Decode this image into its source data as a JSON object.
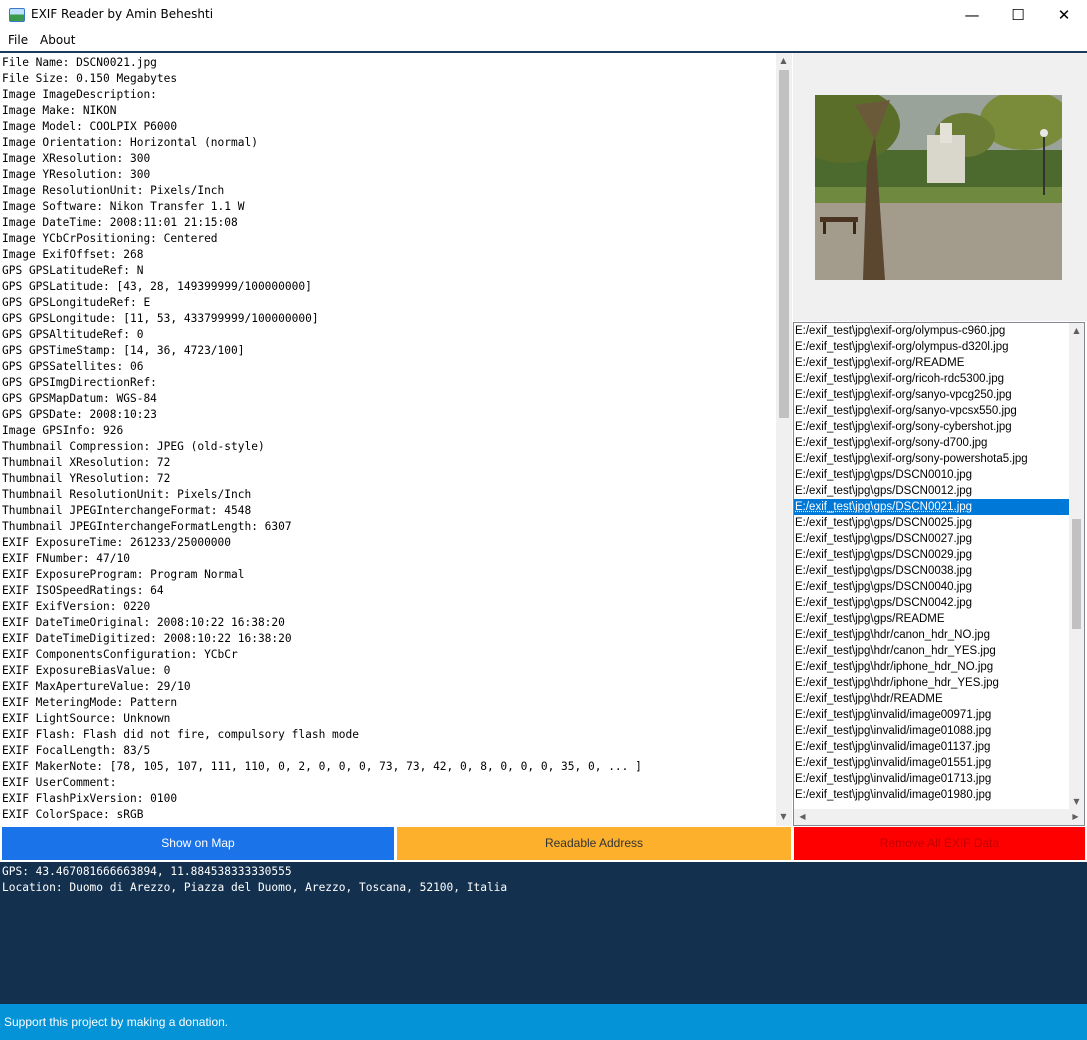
{
  "window": {
    "title": "EXIF Reader by Amin Beheshti",
    "minimize_glyph": "—",
    "maximize_glyph": "☐",
    "close_glyph": "✕"
  },
  "menu": {
    "items": [
      "File",
      "About"
    ]
  },
  "exif_lines": [
    "File Name: DSCN0021.jpg",
    "File Size: 0.150 Megabytes",
    "Image ImageDescription:",
    "Image Make: NIKON",
    "Image Model: COOLPIX P6000",
    "Image Orientation: Horizontal (normal)",
    "Image XResolution: 300",
    "Image YResolution: 300",
    "Image ResolutionUnit: Pixels/Inch",
    "Image Software: Nikon Transfer 1.1 W",
    "Image DateTime: 2008:11:01 21:15:08",
    "Image YCbCrPositioning: Centered",
    "Image ExifOffset: 268",
    "GPS GPSLatitudeRef: N",
    "GPS GPSLatitude: [43, 28, 149399999/100000000]",
    "GPS GPSLongitudeRef: E",
    "GPS GPSLongitude: [11, 53, 433799999/100000000]",
    "GPS GPSAltitudeRef: 0",
    "GPS GPSTimeStamp: [14, 36, 4723/100]",
    "GPS GPSSatellites: 06",
    "GPS GPSImgDirectionRef:",
    "GPS GPSMapDatum: WGS-84",
    "GPS GPSDate: 2008:10:23",
    "Image GPSInfo: 926",
    "Thumbnail Compression: JPEG (old-style)",
    "Thumbnail XResolution: 72",
    "Thumbnail YResolution: 72",
    "Thumbnail ResolutionUnit: Pixels/Inch",
    "Thumbnail JPEGInterchangeFormat: 4548",
    "Thumbnail JPEGInterchangeFormatLength: 6307",
    "EXIF ExposureTime: 261233/25000000",
    "EXIF FNumber: 47/10",
    "EXIF ExposureProgram: Program Normal",
    "EXIF ISOSpeedRatings: 64",
    "EXIF ExifVersion: 0220",
    "EXIF DateTimeOriginal: 2008:10:22 16:38:20",
    "EXIF DateTimeDigitized: 2008:10:22 16:38:20",
    "EXIF ComponentsConfiguration: YCbCr",
    "EXIF ExposureBiasValue: 0",
    "EXIF MaxApertureValue: 29/10",
    "EXIF MeteringMode: Pattern",
    "EXIF LightSource: Unknown",
    "EXIF Flash: Flash did not fire, compulsory flash mode",
    "EXIF FocalLength: 83/5",
    "EXIF MakerNote: [78, 105, 107, 111, 110, 0, 2, 0, 0, 0, 73, 73, 42, 0, 8, 0, 0, 0, 35, 0, ... ]",
    "EXIF UserComment:",
    "EXIF FlashPixVersion: 0100",
    "EXIF ColorSpace: sRGB"
  ],
  "file_list": {
    "selected_index": 11,
    "items": [
      "E:/exif_test\\jpg\\exif-org/olympus-c960.jpg",
      "E:/exif_test\\jpg\\exif-org/olympus-d320l.jpg",
      "E:/exif_test\\jpg\\exif-org/README",
      "E:/exif_test\\jpg\\exif-org/ricoh-rdc5300.jpg",
      "E:/exif_test\\jpg\\exif-org/sanyo-vpcg250.jpg",
      "E:/exif_test\\jpg\\exif-org/sanyo-vpcsx550.jpg",
      "E:/exif_test\\jpg\\exif-org/sony-cybershot.jpg",
      "E:/exif_test\\jpg\\exif-org/sony-d700.jpg",
      "E:/exif_test\\jpg\\exif-org/sony-powershota5.jpg",
      "E:/exif_test\\jpg\\gps/DSCN0010.jpg",
      "E:/exif_test\\jpg\\gps/DSCN0012.jpg",
      "E:/exif_test\\jpg\\gps/DSCN0021.jpg",
      "E:/exif_test\\jpg\\gps/DSCN0025.jpg",
      "E:/exif_test\\jpg\\gps/DSCN0027.jpg",
      "E:/exif_test\\jpg\\gps/DSCN0029.jpg",
      "E:/exif_test\\jpg\\gps/DSCN0038.jpg",
      "E:/exif_test\\jpg\\gps/DSCN0040.jpg",
      "E:/exif_test\\jpg\\gps/DSCN0042.jpg",
      "E:/exif_test\\jpg\\gps/README",
      "E:/exif_test\\jpg\\hdr/canon_hdr_NO.jpg",
      "E:/exif_test\\jpg\\hdr/canon_hdr_YES.jpg",
      "E:/exif_test\\jpg\\hdr/iphone_hdr_NO.jpg",
      "E:/exif_test\\jpg\\hdr/iphone_hdr_YES.jpg",
      "E:/exif_test\\jpg\\hdr/README",
      "E:/exif_test\\jpg\\invalid/image00971.jpg",
      "E:/exif_test\\jpg\\invalid/image01088.jpg",
      "E:/exif_test\\jpg\\invalid/image01137.jpg",
      "E:/exif_test\\jpg\\invalid/image01551.jpg",
      "E:/exif_test\\jpg\\invalid/image01713.jpg",
      "E:/exif_test\\jpg\\invalid/image01980.jpg"
    ]
  },
  "buttons": {
    "show_on_map": "Show on Map",
    "readable_address": "Readable Address",
    "remove_exif": "Remove All EXIF Data"
  },
  "colors": {
    "show_on_map_bg": "#1a73e8",
    "readable_address_bg": "#fcb02c",
    "remove_exif_bg": "#ff0000",
    "output_bg": "#13304e",
    "status_bg": "#0593d8",
    "selection": "#0078d7"
  },
  "icons": {
    "scroll_up": "up-arrow-icon",
    "scroll_down": "down-arrow-icon",
    "scroll_left": "left-arrow-icon",
    "scroll_right": "right-arrow-icon"
  },
  "output": {
    "gps_line": "GPS: 43.467081666663894, 11.884538333330555",
    "location_line": "Location: Duomo di Arezzo, Piazza del Duomo, Arezzo, Toscana, 52100, Italia"
  },
  "status": {
    "text": "Support this project by making a donation."
  }
}
